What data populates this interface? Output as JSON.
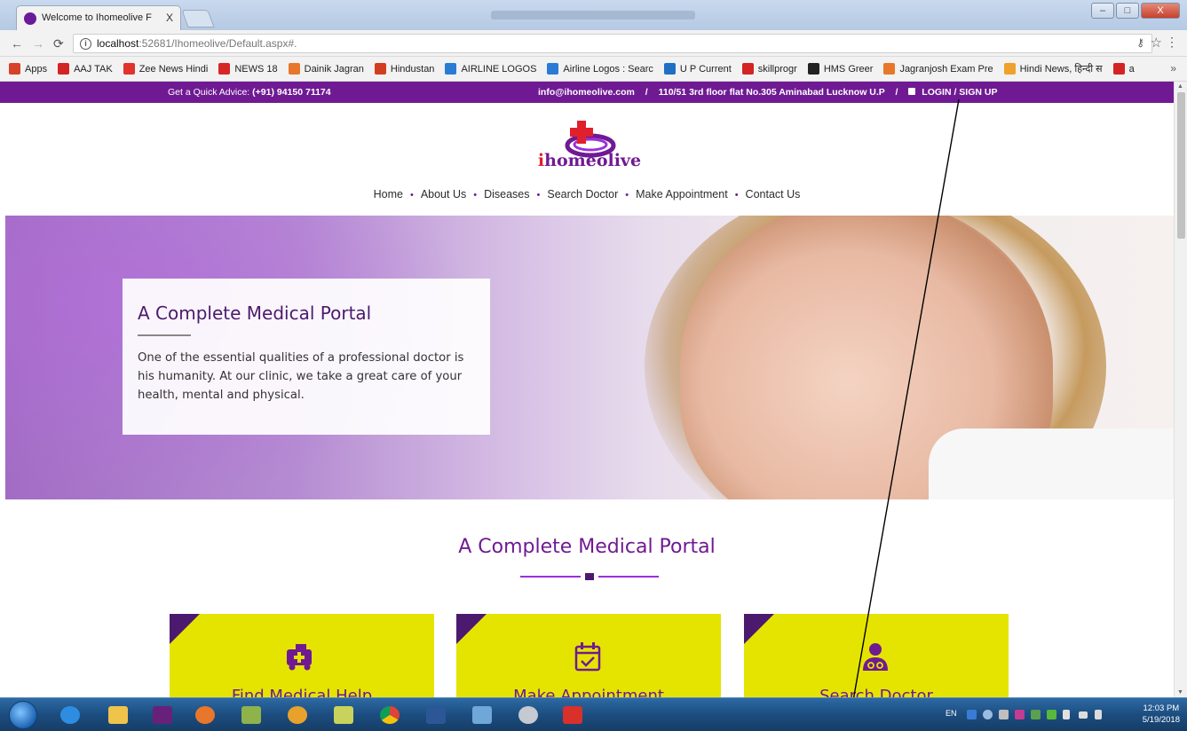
{
  "browser": {
    "tab_title": "Welcome to Ihomeolive F",
    "tab_close": "X",
    "url_host": "localhost",
    "url_rest": ":52681/Ihomeolive/Default.aspx#.",
    "window_buttons": [
      "–",
      "□",
      "X"
    ]
  },
  "bookmarks": [
    {
      "label": "Apps",
      "color": "#d7402b"
    },
    {
      "label": "AAJ TAK",
      "color": "#d32323"
    },
    {
      "label": "Zee News Hindi",
      "color": "#e0332b"
    },
    {
      "label": "NEWS 18",
      "color": "#d72626"
    },
    {
      "label": "Dainik Jagran",
      "color": "#e8762b"
    },
    {
      "label": "Hindustan",
      "color": "#d33d1f"
    },
    {
      "label": "AIRLINE LOGOS",
      "color": "#2a7bd6"
    },
    {
      "label": "Airline Logos : Searc",
      "color": "#2a7bd6"
    },
    {
      "label": "U P Current",
      "color": "#1f6fc4"
    },
    {
      "label": "skillprogr",
      "color": "#d32323"
    },
    {
      "label": "HMS Greer",
      "color": "#222222"
    },
    {
      "label": "Jagranjosh Exam Pre",
      "color": "#e8762b"
    },
    {
      "label": "Hindi News, हिन्दी स",
      "color": "#f0a12b"
    },
    {
      "label": "a",
      "color": "#d32323"
    }
  ],
  "bookmarks_more": "»",
  "site": {
    "advice_label": "Get a Quick Advice:",
    "advice_phone": "(+91) 94150 71174",
    "email": "info@ihomeolive.com",
    "separator": "/",
    "address": "110/51 3rd floor flat No.305 Aminabad Lucknow U.P",
    "login": "LOGIN / SIGN UP",
    "logo_i": "i",
    "logo_rest": "homeolive",
    "nav": [
      "Home",
      "About Us",
      "Diseases",
      "Search Doctor",
      "Make Appointment",
      "Contact Us"
    ],
    "nav_dot": "•",
    "hero_title": "A Complete Medical Portal",
    "hero_text": "One of the essential qualities of a professional doctor is his humanity. At our clinic, we take a great care of your health, mental and physical.",
    "section_title": "A Complete Medical Portal",
    "cards": [
      {
        "label": "Find Medical Help",
        "icon": "ambulance-icon"
      },
      {
        "label": "Make Appointment",
        "icon": "calendar-check-icon"
      },
      {
        "label": "Search Doctor",
        "icon": "doctor-icon"
      }
    ],
    "colors": {
      "brand_purple": "#6f1a93",
      "dark_purple": "#4b1a6e",
      "card_yellow": "#e5e400",
      "logo_red": "#e0202c"
    }
  },
  "taskbar": {
    "lang": "EN",
    "time": "12:03 PM",
    "date": "5/19/2018"
  }
}
